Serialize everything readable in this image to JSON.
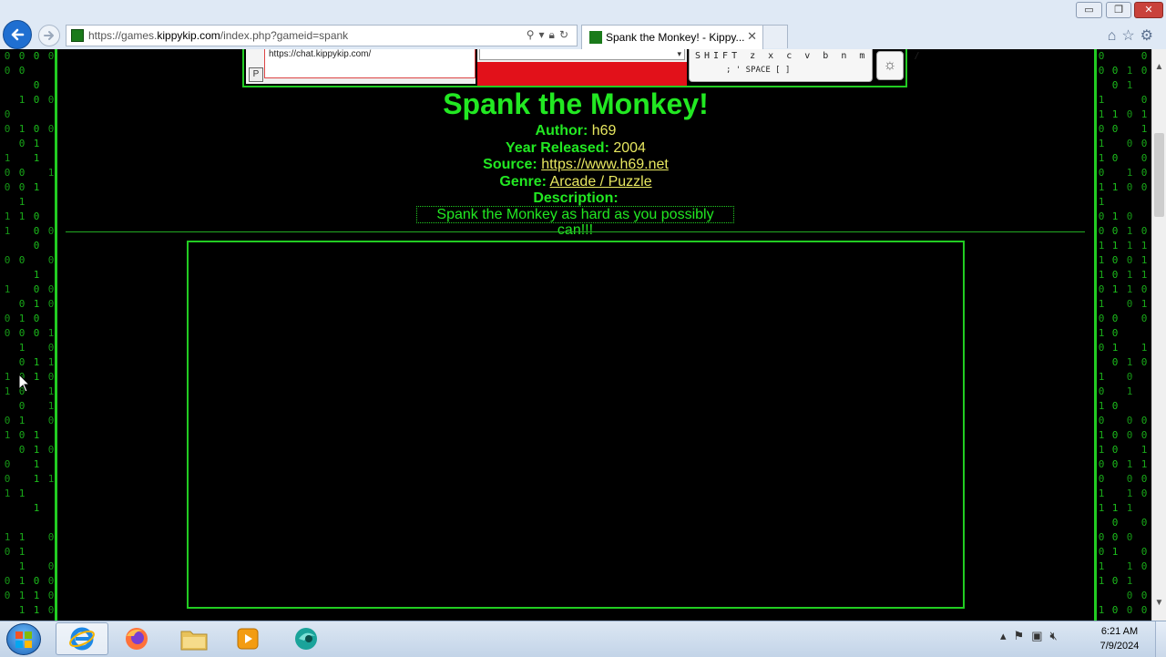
{
  "browser": {
    "url_prefix": "https://games.",
    "url_domain": "kippykip.com",
    "url_path": "/index.php?gameid=spank",
    "tab_title": "Spank the Monkey! - Kippy...",
    "tab_close": "✕",
    "window_controls": {
      "minimize": "▭",
      "maximize": "❐",
      "close": "✕"
    },
    "icons": [
      "back-icon",
      "forward-icon",
      "search-icon",
      "lock-icon",
      "refresh-icon",
      "home-icon",
      "favorites-star-icon",
      "settings-gear-icon"
    ]
  },
  "toolbar": {
    "chat_url": "https://chat.kippykip.com/",
    "keys_row1": "SHIFT z x c v b n m , . /",
    "keys_row2": ";  '      SPACE      [ ]",
    "p_button": "P"
  },
  "game": {
    "title": "Spank the Monkey!",
    "author_label": "Author:",
    "author": "h69",
    "year_label": "Year Released:",
    "year": "2004",
    "source_label": "Source:",
    "source": "https://www.h69.net",
    "genre_label": "Genre:",
    "genre": "Arcade / Puzzle",
    "description_label": "Description:",
    "description": "Spank the Monkey as hard as you possibly can!!!"
  },
  "taskbar": {
    "apps": [
      "internet-explorer",
      "firefox",
      "file-explorer",
      "media-player",
      "browser-app"
    ],
    "time": "6:21 AM",
    "date": "7/9/2024"
  },
  "colors": {
    "accent_green": "#22e822",
    "link_yellow": "#e8e860",
    "background": "#000000"
  }
}
